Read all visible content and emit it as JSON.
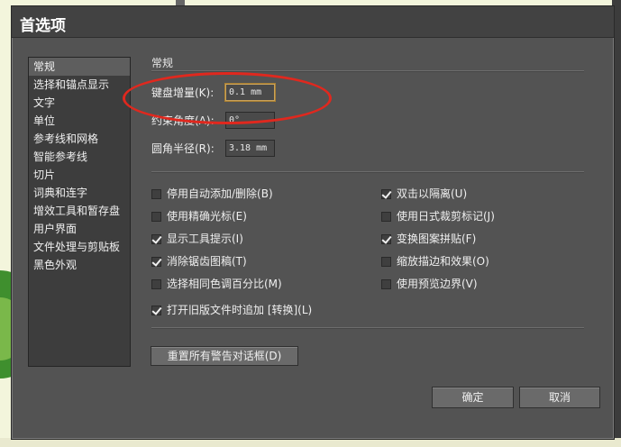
{
  "dialog": {
    "title": "首选项"
  },
  "categories": [
    "常规",
    "选择和锚点显示",
    "文字",
    "单位",
    "参考线和网格",
    "智能参考线",
    "切片",
    "词典和连字",
    "增效工具和暂存盘",
    "用户界面",
    "文件处理与剪贴板",
    "黑色外观"
  ],
  "general": {
    "section_title": "常规",
    "keyboard_increment": {
      "label": "键盘增量(K):",
      "value": "0.1 mm"
    },
    "constrain_angle": {
      "label": "约束角度(A):",
      "value": "0°"
    },
    "corner_radius": {
      "label": "圆角半径(R):",
      "value": "3.18 mm"
    }
  },
  "options_left": [
    {
      "label": "停用自动添加/删除(B)",
      "checked": false
    },
    {
      "label": "使用精确光标(E)",
      "checked": false
    },
    {
      "label": "显示工具提示(I)",
      "checked": true
    },
    {
      "label": "消除锯齿图稿(T)",
      "checked": true
    },
    {
      "label": "选择相同色调百分比(M)",
      "checked": false
    }
  ],
  "options_right": [
    {
      "label": "双击以隔离(U)",
      "checked": true
    },
    {
      "label": "使用日式裁剪标记(J)",
      "checked": false
    },
    {
      "label": "变换图案拼贴(F)",
      "checked": true
    },
    {
      "label": "缩放描边和效果(O)",
      "checked": false
    },
    {
      "label": "使用预览边界(V)",
      "checked": false
    }
  ],
  "legacy_option": {
    "label": "打开旧版文件时追加 [转换](L)",
    "checked": true
  },
  "buttons": {
    "reset_warnings": "重置所有警告对话框(D)",
    "ok": "确定",
    "cancel": "取消"
  },
  "colors": {
    "dialog_bg": "#535353",
    "highlight": "#e0281e",
    "focus_border": "#c9a25a"
  }
}
